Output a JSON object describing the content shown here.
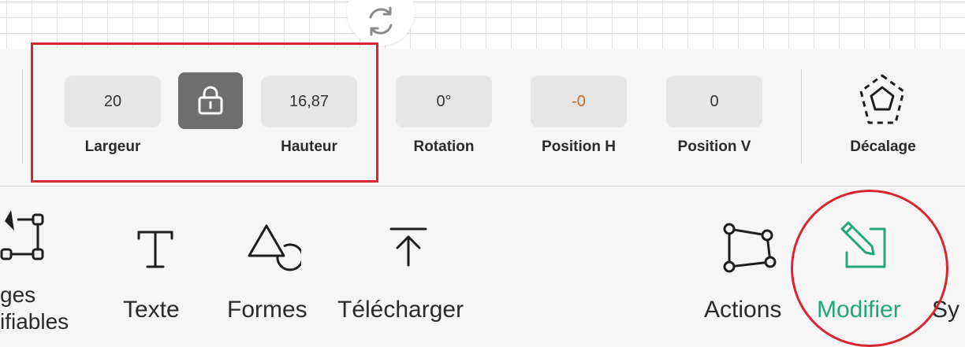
{
  "colors": {
    "accent_green": "#21a779",
    "highlight_red": "#d6262f",
    "negative_orange": "#d2681c",
    "lock_bg": "#6e6e6e"
  },
  "canvas": {
    "rotate_icon": "rotate-icon"
  },
  "properties": {
    "width": {
      "value": "20",
      "label": "Largeur"
    },
    "lock": {
      "icon": "lock-icon",
      "locked": true
    },
    "height": {
      "value": "16,87",
      "label": "Hauteur"
    },
    "rotation": {
      "value": "0°",
      "label": "Rotation"
    },
    "position_h": {
      "value": "-0",
      "label": "Position H"
    },
    "position_v": {
      "value": "0",
      "label": "Position V"
    },
    "offset": {
      "icon": "offset-pentagon-icon",
      "label": "Décalage"
    }
  },
  "tools": {
    "images": {
      "line1": "ges",
      "line2": "ifiables",
      "icon": "edit-nodes-icon"
    },
    "text": {
      "label": "Texte",
      "icon": "text-icon"
    },
    "shapes": {
      "label": "Formes",
      "icon": "shapes-icon"
    },
    "upload": {
      "label": "Télécharger",
      "icon": "upload-icon"
    },
    "actions": {
      "label": "Actions",
      "icon": "actions-polygon-icon"
    },
    "edit": {
      "label": "Modifier",
      "icon": "edit-pencil-icon",
      "active": true
    },
    "symbols": {
      "label": "Sy"
    }
  }
}
